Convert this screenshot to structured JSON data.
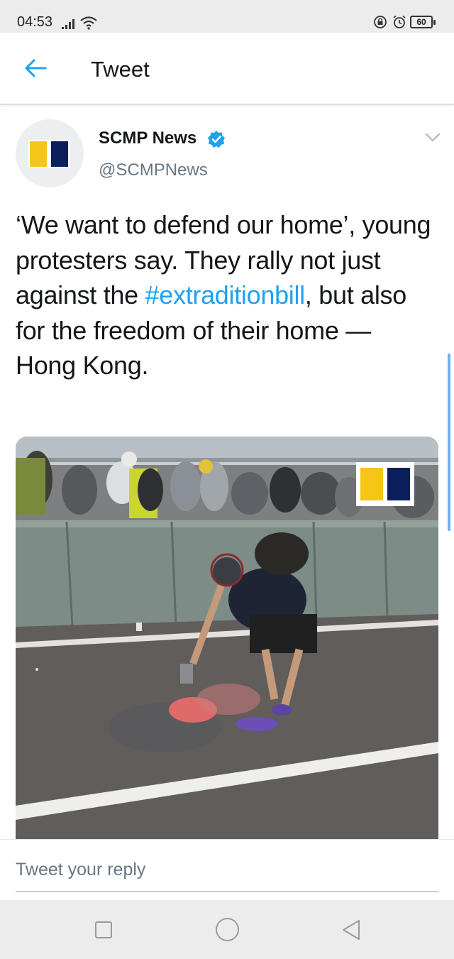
{
  "status_bar": {
    "time": "04:53",
    "battery": "60",
    "icons": [
      "signal-icon",
      "wifi-icon",
      "lock-icon",
      "alarm-icon",
      "battery-icon"
    ]
  },
  "header": {
    "back_icon": "arrow-left-icon",
    "title": "Tweet",
    "accent_color": "#1da1f2"
  },
  "tweet": {
    "author": {
      "name": "SCMP News",
      "handle": "@SCMPNews",
      "verified": true,
      "logo_colors": [
        "#f5c518",
        "#0a1f5c"
      ]
    },
    "text_before": "‘We want to defend our home’, young protesters say. They rally not just against the ",
    "hashtag": "#extraditionbill",
    "text_after": ", but also for the freedom of their home — Hong Kong.",
    "media": {
      "type": "video-still",
      "description_icon": "scmp-logo-icon"
    }
  },
  "reply": {
    "placeholder": "Tweet your reply"
  },
  "nav_bar": {
    "buttons": [
      "recent-apps-icon",
      "home-icon",
      "back-icon"
    ]
  }
}
